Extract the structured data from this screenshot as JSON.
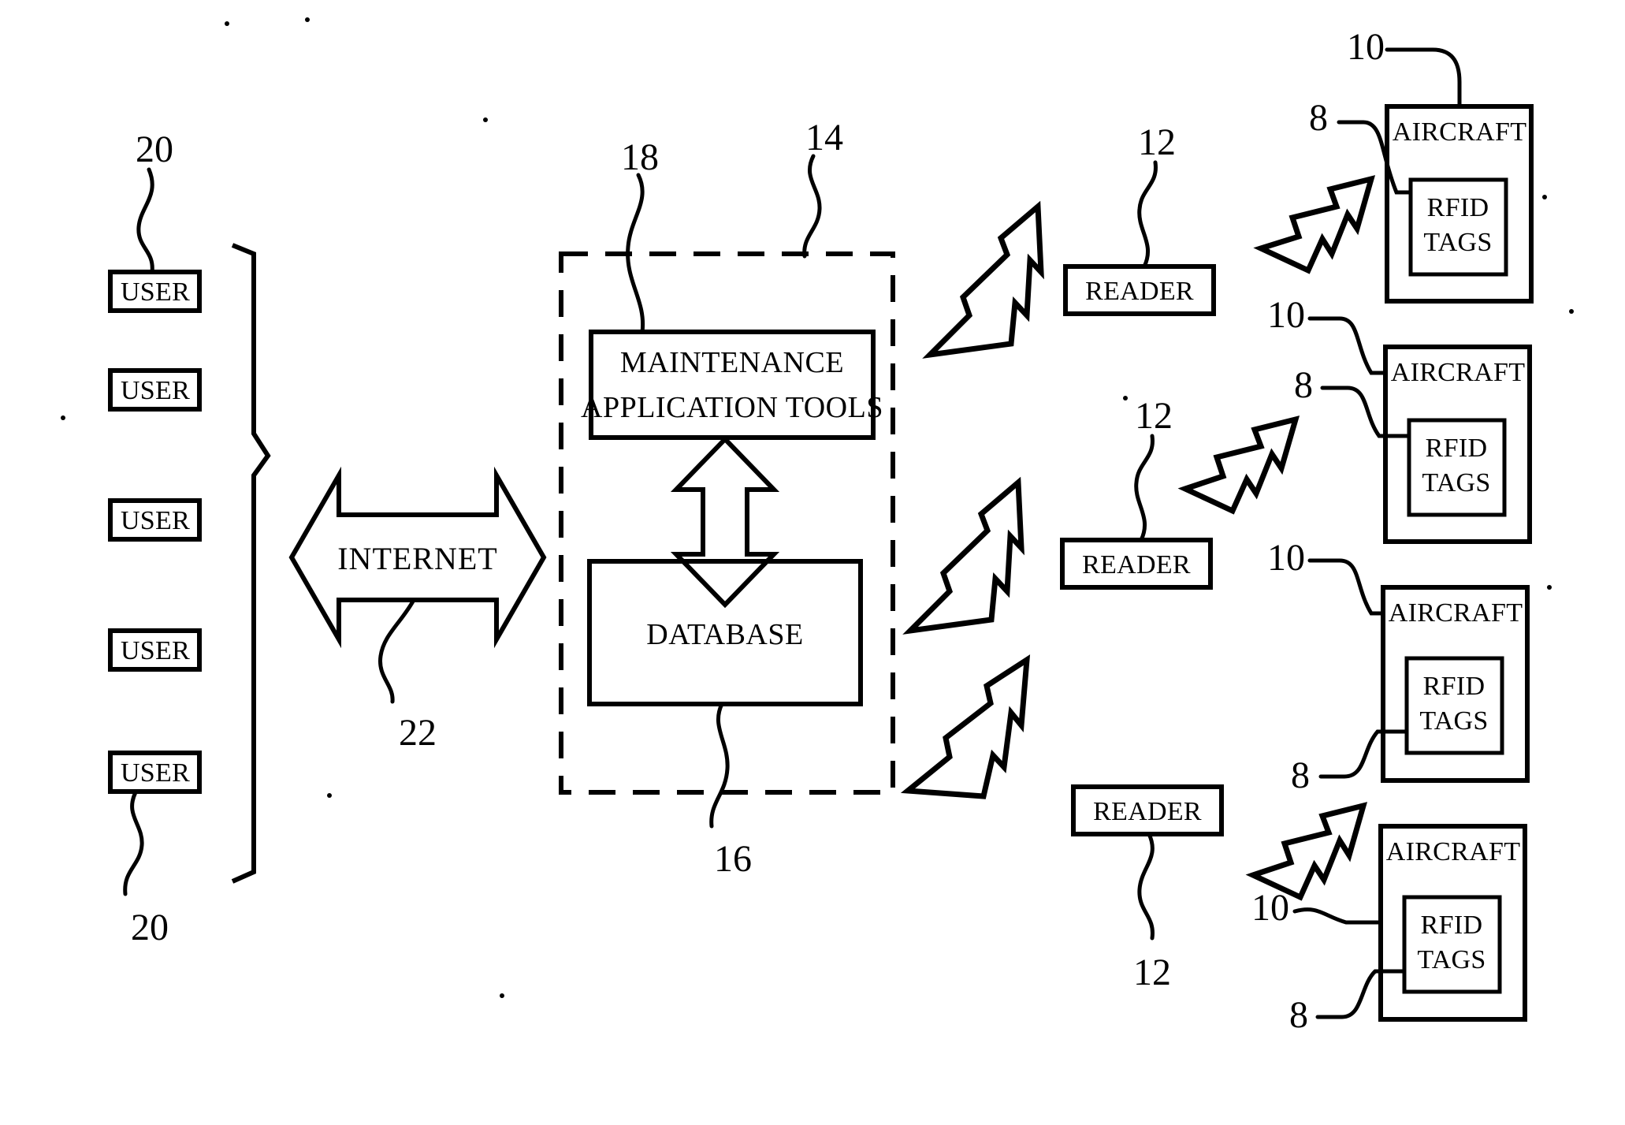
{
  "figure": {
    "title": "RFID aircraft maintenance system block diagram",
    "line_color": "#000000",
    "background_color": "#ffffff"
  },
  "users": {
    "label": "USER",
    "count": 5,
    "ref_top": "20",
    "ref_bottom": "20",
    "items": [
      {
        "label": "USER"
      },
      {
        "label": "USER"
      },
      {
        "label": "USER"
      },
      {
        "label": "USER"
      },
      {
        "label": "USER"
      }
    ]
  },
  "internet": {
    "label": "INTERNET",
    "ref": "22"
  },
  "server": {
    "ref": "14",
    "tools": {
      "line1": "MAINTENANCE",
      "line2": "APPLICATION TOOLS",
      "ref": "18"
    },
    "database": {
      "label": "DATABASE",
      "ref": "16"
    }
  },
  "readers": [
    {
      "label": "READER",
      "ref": "12"
    },
    {
      "label": "READER",
      "ref": "12"
    },
    {
      "label": "READER",
      "ref": "12"
    }
  ],
  "aircraft": [
    {
      "label": "AIRCRAFT",
      "tag_line1": "RFID",
      "tag_line2": "TAGS",
      "ref_aircraft": "10",
      "ref_tags": "8"
    },
    {
      "label": "AIRCRAFT",
      "tag_line1": "RFID",
      "tag_line2": "TAGS",
      "ref_aircraft": "10",
      "ref_tags": "8"
    },
    {
      "label": "AIRCRAFT",
      "tag_line1": "RFID",
      "tag_line2": "TAGS",
      "ref_aircraft": "10",
      "ref_tags": "8"
    },
    {
      "label": "AIRCRAFT",
      "tag_line1": "RFID",
      "tag_line2": "TAGS",
      "ref_aircraft": "10",
      "ref_tags": "8"
    }
  ],
  "reference_numerals": {
    "rfid_tags": "8",
    "aircraft": "10",
    "reader": "12",
    "server_boundary": "14",
    "database": "16",
    "maintenance_tools": "18",
    "user": "20",
    "internet": "22"
  }
}
